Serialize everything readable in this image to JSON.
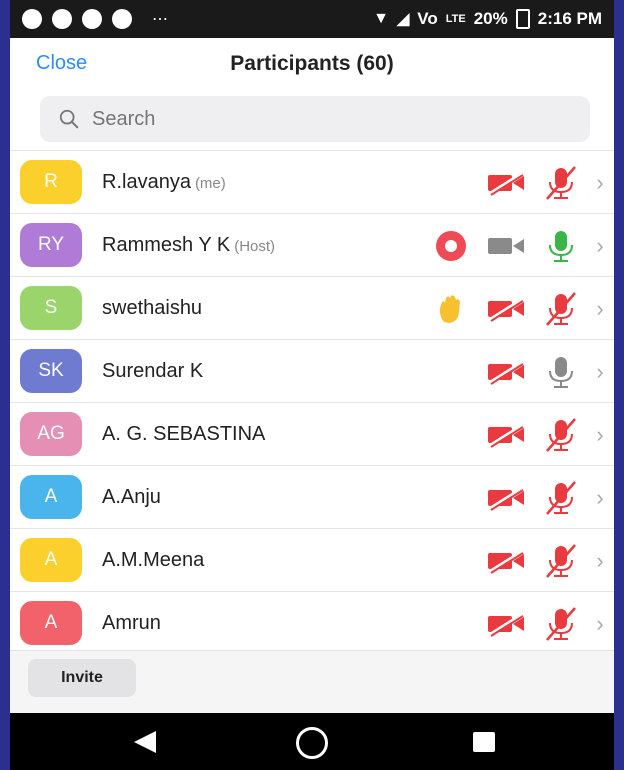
{
  "statusbar": {
    "battery": "20%",
    "time": "2:16 PM",
    "signal": "Vo",
    "network": "LTE"
  },
  "header": {
    "close_label": "Close",
    "title": "Participants (60)"
  },
  "search": {
    "placeholder": "Search"
  },
  "participants": [
    {
      "initials": "R",
      "name": "R.lavanya",
      "tag": "(me)",
      "color": "#fcd02c",
      "hand": false,
      "recording": false,
      "video": "off",
      "mic": "muted"
    },
    {
      "initials": "RY",
      "name": "Rammesh Y K",
      "tag": "(Host)",
      "color": "#b07bd6",
      "hand": false,
      "recording": true,
      "video": "on",
      "mic": "active"
    },
    {
      "initials": "S",
      "name": "swethaishu",
      "tag": "",
      "color": "#9ad46a",
      "hand": true,
      "recording": false,
      "video": "off",
      "mic": "muted"
    },
    {
      "initials": "SK",
      "name": "Surendar K",
      "tag": "",
      "color": "#6f7bd0",
      "hand": false,
      "recording": false,
      "video": "off",
      "mic": "idle"
    },
    {
      "initials": "AG",
      "name": "A. G. SEBASTINA",
      "tag": "",
      "color": "#e48fb3",
      "hand": false,
      "recording": false,
      "video": "off",
      "mic": "muted"
    },
    {
      "initials": "A",
      "name": "A.Anju",
      "tag": "",
      "color": "#4ab5ec",
      "hand": false,
      "recording": false,
      "video": "off",
      "mic": "muted"
    },
    {
      "initials": "A",
      "name": "A.M.Meena",
      "tag": "",
      "color": "#fcd02c",
      "hand": false,
      "recording": false,
      "video": "off",
      "mic": "muted"
    },
    {
      "initials": "A",
      "name": "Amrun",
      "tag": "",
      "color": "#f2626a",
      "hand": false,
      "recording": false,
      "video": "off",
      "mic": "muted"
    }
  ],
  "footer": {
    "invite_label": "Invite"
  },
  "colors": {
    "accent": "#2d8cff",
    "muted_red": "#e83a3f",
    "active_green": "#3bb54a",
    "idle_gray": "#8a8a8a"
  }
}
